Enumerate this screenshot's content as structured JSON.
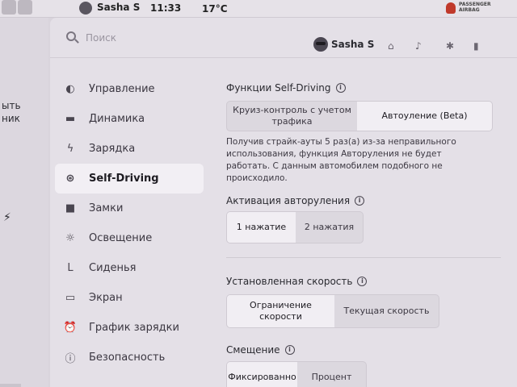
{
  "statusbar": {
    "user": "Sasha S",
    "time": "11:33",
    "temperature": "17°C",
    "airbag_line1": "PASSENGER",
    "airbag_line2": "AIRBAG"
  },
  "left_fragments": [
    "ыть",
    "ник"
  ],
  "header": {
    "search_placeholder": "Поиск",
    "profile_name": "Sasha S"
  },
  "nav": {
    "items": [
      {
        "label": "Управление",
        "icon": "toggle-icon"
      },
      {
        "label": "Динамика",
        "icon": "car-icon"
      },
      {
        "label": "Зарядка",
        "icon": "bolt-icon"
      },
      {
        "label": "Self-Driving",
        "icon": "steering-wheel-icon",
        "active": true
      },
      {
        "label": "Замки",
        "icon": "lock-icon"
      },
      {
        "label": "Освещение",
        "icon": "sun-icon"
      },
      {
        "label": "Сиденья",
        "icon": "seat-icon"
      },
      {
        "label": "Экран",
        "icon": "display-icon"
      },
      {
        "label": "График зарядки",
        "icon": "alarm-clock-icon"
      },
      {
        "label": "Безопасность",
        "icon": "alert-icon"
      }
    ]
  },
  "self_driving": {
    "title": "Функции Self-Driving",
    "features": {
      "option1": "Круиз-контроль с учетом трафика",
      "option2": "Автоуление (Beta)",
      "selected": "option2"
    },
    "notice": "Получив страйк-ауты 5 раз(а) из-за неправильного использования, функция Авторуления не будет работать. С данным автомобилем подобного не происходило.",
    "activation": {
      "title": "Активация авторуления",
      "option1": "1 нажатие",
      "option2": "2 нажатия",
      "selected": "option1"
    },
    "set_speed": {
      "title": "Установленная скорость",
      "option1": "Ограничение скорости",
      "option2": "Текущая скорость",
      "selected": "option1"
    },
    "offset": {
      "title": "Смещение",
      "option1": "Фиксированно",
      "option2": "Процент",
      "selected": "option1"
    }
  }
}
